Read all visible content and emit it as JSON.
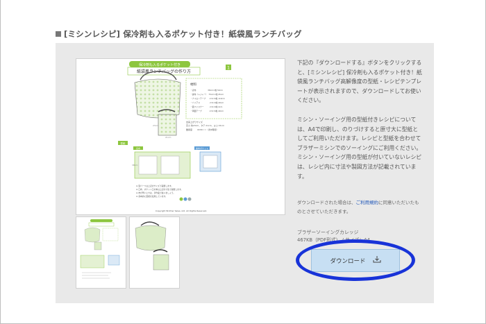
{
  "page": {
    "title": "[ミシンレシピ] 保冷剤も入るポケット付き！紙袋風ランチバッグ"
  },
  "preview": {
    "sheet_banner": "保冷剤も入るポケット付き",
    "sheet_heading": "紙袋風ランチバッグの作り方",
    "page_number": "1",
    "materials_heading": "材料",
    "materials": [
      "・表布　　　　　　38cm×幅 50cm",
      "・裏布（レジャー）　75cm×幅 45cm",
      "・ナイロンテープ　　2.5cm幅 110cm",
      "・バイアス　　　　　2.5cm幅 40cm",
      "・面ファスナー　　　2.5cm幅 4cm",
      "・両面テープ　　　　2.5cm幅 40cm"
    ],
    "size_label": "出来上がりサイズ",
    "size_value": "高さ 約23cm、タテ 21cm、ヨコ 15cm",
    "level_label": "難易度",
    "level_value": "★★★☆☆（約2時間）",
    "pattern_label": "型紙",
    "pattern_tags": [
      "表布",
      "裏布ポケット"
    ],
    "notes": [
      "※ 型パーツは上記のサイズで裁断します。",
      "※ 口布、ポケット口の布は上記の寸法で裁断します。",
      "※ 布が厚いときは、手作業で縫いましょう。",
      "※ 基本的に型紙を使用しています。"
    ],
    "copyright": "Copyright Brother Sales, Ltd. All Rights Reserved."
  },
  "description": {
    "para1": "下記の『ダウンロードする』ボタンをクリックすると、[ミシンレシピ] 保冷剤も入るポケット付き！紙袋風ランチバッグ高解像度の型紙・レシピテンプレートが表示されますので、ダウンロードしてお使いください。",
    "para2": "ミシン・ソーイング用の型紙付きレシピについては、A4で印刷し、のりづけすると原寸大に型紙としてご利用いただけます。レシピと型紙を合わせてブラザーミシンでのソーイングにご利用ください。",
    "para3": "ミシン・ソーイング用の型紙が付いていないレシピは、レシピ内に寸法や製図方法が記載されています。"
  },
  "note": {
    "before_link": "ダウンロードされた場合は、",
    "link": "ご利用規約",
    "after_link": "に同意いただいたものとさせていただきます。"
  },
  "file": {
    "publisher": "ブラザーソーイングカレッジ",
    "info": "467KB（PDF形式） / サイズ：A4"
  },
  "download": {
    "label": "ダウンロード"
  },
  "colors": {
    "accent_green": "#8dc63f",
    "dot_green": "#cfe7b4",
    "button_bg": "#c7dff3",
    "highlight": "#1833d8",
    "link": "#1f56b8"
  }
}
